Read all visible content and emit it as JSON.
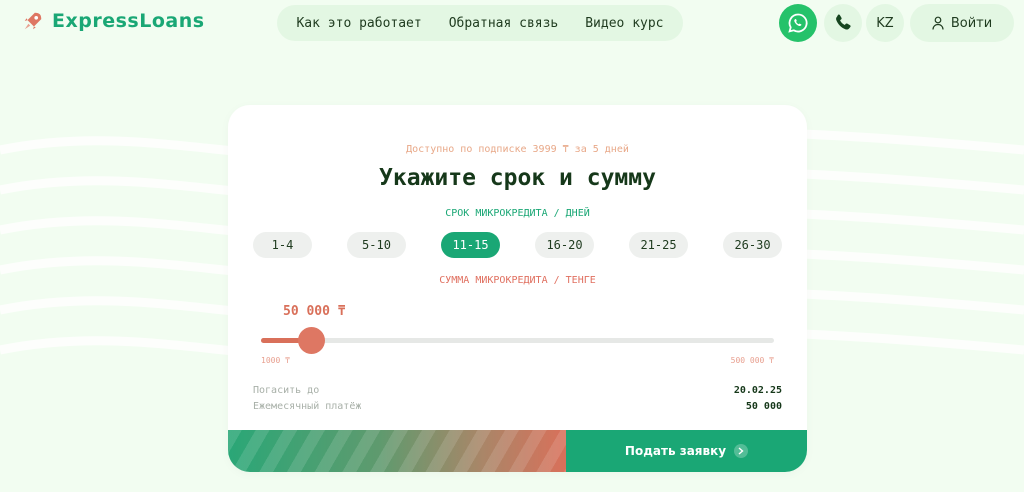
{
  "header": {
    "brand": "ExpressLoans",
    "nav": [
      "Как это работает",
      "Обратная связь",
      "Видео курс"
    ],
    "lang": "KZ",
    "login": "Войти"
  },
  "calculator": {
    "subscription_note": "Доступно по подписке 3999 ₸ за 5 дней",
    "title": "Укажите срок и сумму",
    "term_label": "СРОК МИКРОКРЕДИТА / ДНЕЙ",
    "terms": [
      "1-4",
      "5-10",
      "11-15",
      "16-20",
      "21-25",
      "26-30"
    ],
    "selected_term": "11-15",
    "sum_label": "СУММА МИКРОКРЕДИТА / ТЕНГЕ",
    "sum_value": "50 000 ₸",
    "slider": {
      "min": 1000,
      "max": 500000,
      "value": 50000
    },
    "min_label": "1000 ₸",
    "max_label": "500 000 ₸",
    "repay_label": "Погасить до",
    "repay_value": "20.02.25",
    "monthly_label": "Ежемесячный платёж",
    "monthly_value": "50 000",
    "submit": "Подать заявку"
  },
  "colors": {
    "accent": "#1aa775",
    "coral": "#d9705a",
    "background": "#f2fdf1"
  },
  "icons": [
    "rocket-icon",
    "whatsapp-icon",
    "phone-icon",
    "user-icon",
    "chevron-right-icon"
  ]
}
